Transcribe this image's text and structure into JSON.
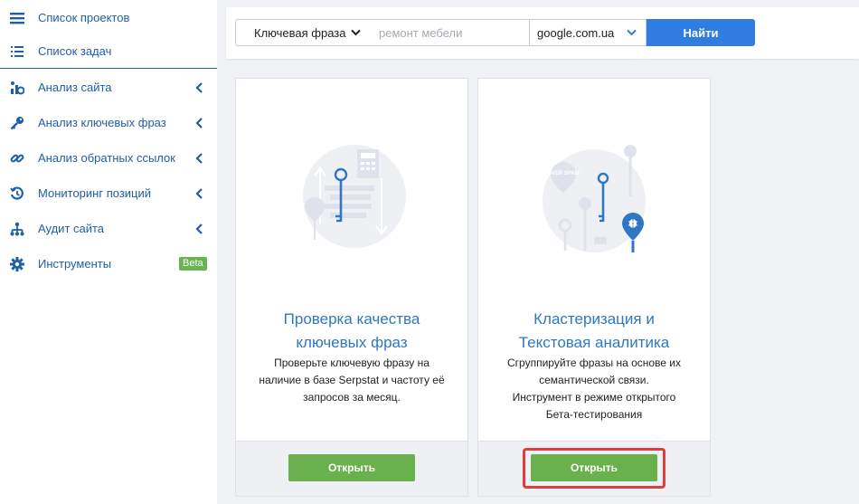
{
  "sidebar": {
    "items": [
      {
        "label": "Список проектов",
        "icon": "hamburger-icon"
      },
      {
        "label": "Список задач",
        "icon": "list-icon"
      },
      {
        "label": "Анализ сайта",
        "icon": "site-analysis-icon"
      },
      {
        "label": "Анализ ключевых фраз",
        "icon": "key-icon"
      },
      {
        "label": "Анализ обратных ссылок",
        "icon": "link-icon"
      },
      {
        "label": "Мониторинг позиций",
        "icon": "history-icon"
      },
      {
        "label": "Аудит сайта",
        "icon": "sitemap-icon"
      },
      {
        "label": "Инструменты",
        "icon": "gear-icon",
        "badge": "Beta"
      }
    ]
  },
  "search": {
    "type_label": "Ключевая фраза",
    "keyword_placeholder": "ремонт мебели",
    "keyword_value": "",
    "domain_label": "google.com.ua",
    "find_label": "Найти"
  },
  "cards": [
    {
      "title_line1": "Проверка качества",
      "title_line2": "ключевых фраз",
      "desc": [
        "Проверьте ключевую фразу на",
        "наличие в базе Serpstat и частоту её",
        "запросов за месяц."
      ],
      "button": "Открыть"
    },
    {
      "title_line1": "Кластеризация и",
      "title_line2": "Текстовая аналитика",
      "desc": [
        "Сгруппируйте фразы на основе их",
        "семантической связи.",
        "Инструмент в режиме открытого",
        "Бета-тестирования"
      ],
      "button": "Открыть",
      "illus_badge": "OVER SPAM"
    }
  ],
  "colors": {
    "accent": "#2f7de1",
    "link": "#1f5fa8",
    "green": "#6ab04c",
    "highlight": "#e23d3d"
  }
}
